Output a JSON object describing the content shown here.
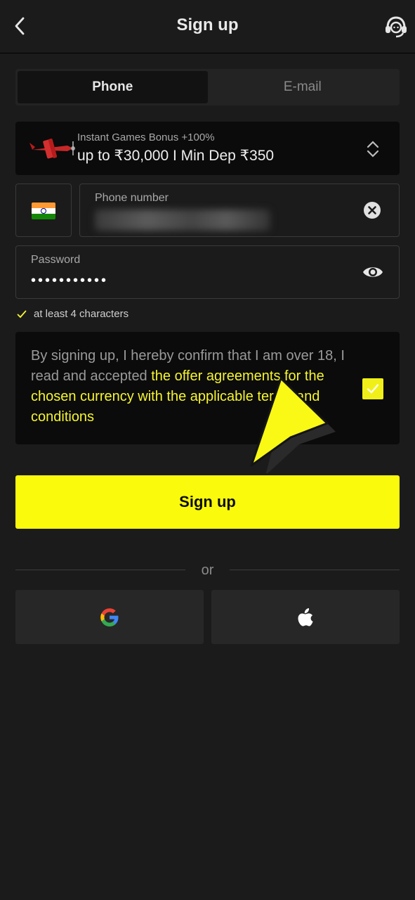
{
  "header": {
    "title": "Sign up"
  },
  "tabs": [
    {
      "label": "Phone",
      "active": true
    },
    {
      "label": "E-mail",
      "active": false
    }
  ],
  "bonus": {
    "subtitle": "Instant Games Bonus +100%",
    "title": "up to ₹30,000 I Min Dep ₹350"
  },
  "phone": {
    "country": "India",
    "label": "Phone number",
    "value": ""
  },
  "password": {
    "label": "Password",
    "value": "•••••••••••"
  },
  "hint": {
    "text": "at least 4 characters"
  },
  "consent": {
    "text": "By signing up, I hereby confirm that I am over 18, I read and accepted ",
    "link": "the offer agreements for the chosen currency with the applicable terms and conditions",
    "checked": true
  },
  "signup_button": "Sign up",
  "divider": "or",
  "colors": {
    "accent": "#fafa0c",
    "background": "#1b1b1b",
    "panel": "#0b0b0b"
  },
  "icons": [
    "back-icon",
    "headset-icon",
    "plane-icon",
    "sort-icon",
    "clear-icon",
    "eye-icon",
    "check-icon",
    "google-icon",
    "apple-icon"
  ]
}
